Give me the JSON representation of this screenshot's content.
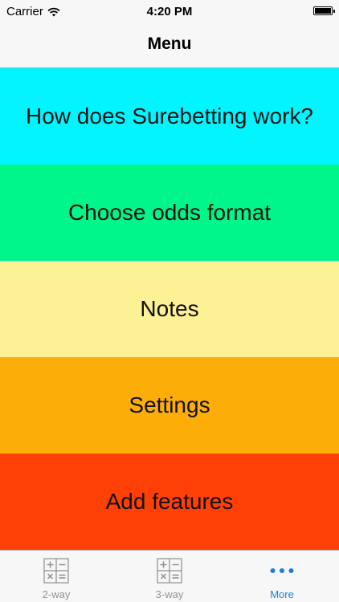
{
  "status_bar": {
    "carrier": "Carrier",
    "time": "4:20 PM",
    "battery_level": 1.0,
    "icons": [
      "wifi-icon",
      "battery-icon"
    ]
  },
  "nav": {
    "title": "Menu"
  },
  "menu": {
    "items": [
      {
        "label": "How does Surebetting work?",
        "color": "#00f5ff"
      },
      {
        "label": "Choose odds format",
        "color": "#00f688"
      },
      {
        "label": "Notes",
        "color": "#fdf196"
      },
      {
        "label": "Settings",
        "color": "#fdad08"
      },
      {
        "label": "Add features",
        "color": "#ff4006"
      }
    ]
  },
  "tab_bar": {
    "tabs": [
      {
        "label": "2-way",
        "icon": "calculator-icon",
        "active": false
      },
      {
        "label": "3-way",
        "icon": "calculator-icon",
        "active": false
      },
      {
        "label": "More",
        "icon": "more-icon",
        "active": true
      }
    ],
    "active_color": "#1a7fe0",
    "inactive_color": "#929292"
  }
}
